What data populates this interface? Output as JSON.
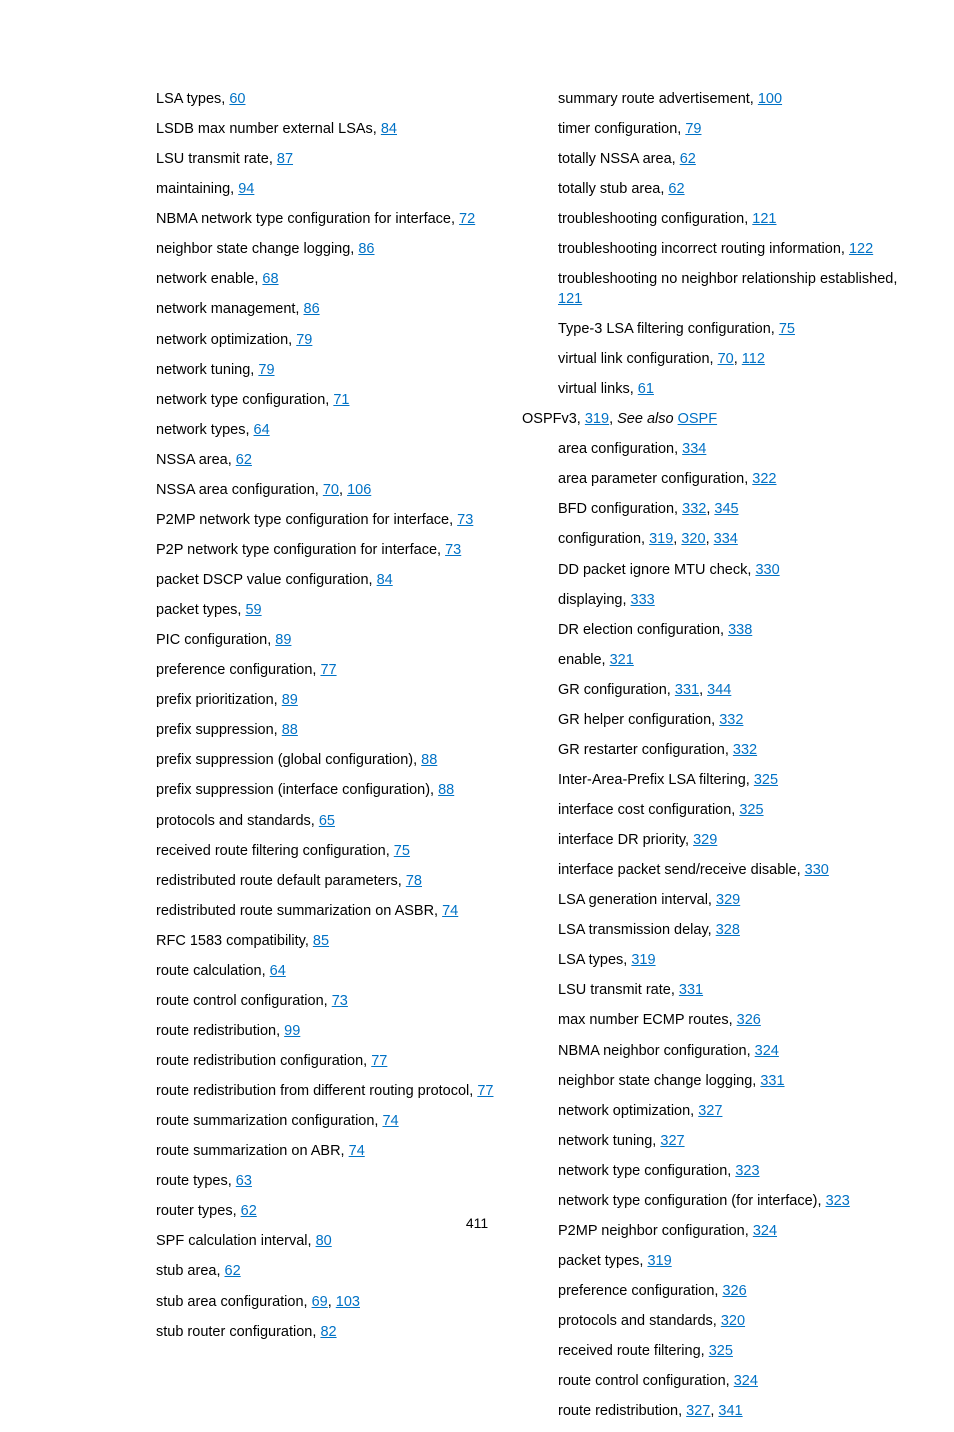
{
  "page_number": "411",
  "left": [
    {
      "text": "LSA types, ",
      "pages": [
        "60"
      ],
      "class": "indent1"
    },
    {
      "text": "LSDB max number external LSAs, ",
      "pages": [
        "84"
      ],
      "class": "indent1"
    },
    {
      "text": "LSU transmit rate, ",
      "pages": [
        "87"
      ],
      "class": "indent1"
    },
    {
      "text": "maintaining, ",
      "pages": [
        "94"
      ],
      "class": "indent1"
    },
    {
      "text": "NBMA network type configuration for interface, ",
      "pages": [
        "72"
      ],
      "class": "indent1"
    },
    {
      "text": "neighbor state change logging, ",
      "pages": [
        "86"
      ],
      "class": "indent1"
    },
    {
      "text": "network enable, ",
      "pages": [
        "68"
      ],
      "class": "indent1"
    },
    {
      "text": "network management, ",
      "pages": [
        "86"
      ],
      "class": "indent1"
    },
    {
      "text": "network optimization, ",
      "pages": [
        "79"
      ],
      "class": "indent1"
    },
    {
      "text": "network tuning, ",
      "pages": [
        "79"
      ],
      "class": "indent1"
    },
    {
      "text": "network type configuration, ",
      "pages": [
        "71"
      ],
      "class": "indent1"
    },
    {
      "text": "network types, ",
      "pages": [
        "64"
      ],
      "class": "indent1"
    },
    {
      "text": "NSSA area, ",
      "pages": [
        "62"
      ],
      "class": "indent1"
    },
    {
      "text": "NSSA area configuration, ",
      "pages": [
        "70",
        "106"
      ],
      "class": "indent1"
    },
    {
      "text": "P2MP network type configuration for interface, ",
      "pages": [
        "73"
      ],
      "class": "indent1"
    },
    {
      "text": "P2P network type configuration for interface, ",
      "pages": [
        "73"
      ],
      "class": "indent1"
    },
    {
      "text": "packet DSCP value configuration, ",
      "pages": [
        "84"
      ],
      "class": "indent1"
    },
    {
      "text": "packet types, ",
      "pages": [
        "59"
      ],
      "class": "indent1"
    },
    {
      "text": "PIC configuration, ",
      "pages": [
        "89"
      ],
      "class": "indent1"
    },
    {
      "text": "preference configuration, ",
      "pages": [
        "77"
      ],
      "class": "indent1"
    },
    {
      "text": "prefix prioritization, ",
      "pages": [
        "89"
      ],
      "class": "indent1"
    },
    {
      "text": "prefix suppression, ",
      "pages": [
        "88"
      ],
      "class": "indent1"
    },
    {
      "text": "prefix suppression (global configuration), ",
      "pages": [
        "88"
      ],
      "class": "indent1"
    },
    {
      "text": "prefix suppression (interface configuration), ",
      "pages": [
        "88"
      ],
      "class": "indent1"
    },
    {
      "text": "protocols and standards, ",
      "pages": [
        "65"
      ],
      "class": "indent1"
    },
    {
      "text": "received route filtering configuration, ",
      "pages": [
        "75"
      ],
      "class": "indent1"
    },
    {
      "text": "redistributed route default parameters, ",
      "pages": [
        "78"
      ],
      "class": "indent1"
    },
    {
      "text": "redistributed route summarization on ASBR, ",
      "pages": [
        "74"
      ],
      "class": "indent1"
    },
    {
      "text": "RFC 1583 compatibility, ",
      "pages": [
        "85"
      ],
      "class": "indent1"
    },
    {
      "text": "route calculation, ",
      "pages": [
        "64"
      ],
      "class": "indent1"
    },
    {
      "text": "route control configuration, ",
      "pages": [
        "73"
      ],
      "class": "indent1"
    },
    {
      "text": "route redistribution, ",
      "pages": [
        "99"
      ],
      "class": "indent1"
    },
    {
      "text": "route redistribution configuration, ",
      "pages": [
        "77"
      ],
      "class": "indent1"
    },
    {
      "text": "route redistribution from different routing protocol, ",
      "pages": [
        "77"
      ],
      "class": "indent1"
    },
    {
      "text": "route summarization configuration, ",
      "pages": [
        "74"
      ],
      "class": "indent1"
    },
    {
      "text": "route summarization on ABR, ",
      "pages": [
        "74"
      ],
      "class": "indent1"
    },
    {
      "text": "route types, ",
      "pages": [
        "63"
      ],
      "class": "indent1"
    },
    {
      "text": "router types, ",
      "pages": [
        "62"
      ],
      "class": "indent1"
    },
    {
      "text": "SPF calculation interval, ",
      "pages": [
        "80"
      ],
      "class": "indent1"
    },
    {
      "text": "stub area, ",
      "pages": [
        "62"
      ],
      "class": "indent1"
    },
    {
      "text": "stub area configuration, ",
      "pages": [
        "69",
        "103"
      ],
      "class": "indent1"
    },
    {
      "text": "stub router configuration, ",
      "pages": [
        "82"
      ],
      "class": "indent1"
    }
  ],
  "right": [
    {
      "text": "summary route advertisement, ",
      "pages": [
        "100"
      ],
      "class": "indent1"
    },
    {
      "text": "timer configuration, ",
      "pages": [
        "79"
      ],
      "class": "indent1"
    },
    {
      "text": "totally NSSA area, ",
      "pages": [
        "62"
      ],
      "class": "indent1"
    },
    {
      "text": "totally stub area, ",
      "pages": [
        "62"
      ],
      "class": "indent1"
    },
    {
      "text": "troubleshooting configuration, ",
      "pages": [
        "121"
      ],
      "class": "indent1"
    },
    {
      "text": "troubleshooting incorrect routing information, ",
      "pages": [
        "122"
      ],
      "class": "indent1"
    },
    {
      "text": "troubleshooting no neighbor relationship established, ",
      "pages": [
        "121"
      ],
      "class": "indent1"
    },
    {
      "text": "Type-3 LSA filtering configuration, ",
      "pages": [
        "75"
      ],
      "class": "indent1"
    },
    {
      "text": "virtual link configuration, ",
      "pages": [
        "70",
        "112"
      ],
      "class": "indent1"
    },
    {
      "text": "virtual links, ",
      "pages": [
        "61"
      ],
      "class": "indent1"
    },
    {
      "kind": "ospfv3",
      "class": "topic"
    },
    {
      "text": "area configuration, ",
      "pages": [
        "334"
      ],
      "class": "indent1"
    },
    {
      "text": "area parameter configuration, ",
      "pages": [
        "322"
      ],
      "class": "indent1"
    },
    {
      "text": "BFD configuration, ",
      "pages": [
        "332",
        "345"
      ],
      "class": "indent1"
    },
    {
      "text": "configuration, ",
      "pages": [
        "319",
        "320",
        "334"
      ],
      "class": "indent1"
    },
    {
      "text": "DD packet ignore MTU check, ",
      "pages": [
        "330"
      ],
      "class": "indent1"
    },
    {
      "text": "displaying, ",
      "pages": [
        "333"
      ],
      "class": "indent1"
    },
    {
      "text": "DR election configuration, ",
      "pages": [
        "338"
      ],
      "class": "indent1"
    },
    {
      "text": "enable, ",
      "pages": [
        "321"
      ],
      "class": "indent1"
    },
    {
      "text": "GR configuration, ",
      "pages": [
        "331",
        "344"
      ],
      "class": "indent1"
    },
    {
      "text": "GR helper configuration, ",
      "pages": [
        "332"
      ],
      "class": "indent1"
    },
    {
      "text": "GR restarter configuration, ",
      "pages": [
        "332"
      ],
      "class": "indent1"
    },
    {
      "text": "Inter-Area-Prefix LSA filtering, ",
      "pages": [
        "325"
      ],
      "class": "indent1"
    },
    {
      "text": "interface cost configuration, ",
      "pages": [
        "325"
      ],
      "class": "indent1"
    },
    {
      "text": "interface DR priority, ",
      "pages": [
        "329"
      ],
      "class": "indent1"
    },
    {
      "text": "interface packet send/receive disable, ",
      "pages": [
        "330"
      ],
      "class": "indent1"
    },
    {
      "text": "LSA generation interval, ",
      "pages": [
        "329"
      ],
      "class": "indent1"
    },
    {
      "text": "LSA transmission delay, ",
      "pages": [
        "328"
      ],
      "class": "indent1"
    },
    {
      "text": "LSA types, ",
      "pages": [
        "319"
      ],
      "class": "indent1"
    },
    {
      "text": "LSU transmit rate, ",
      "pages": [
        "331"
      ],
      "class": "indent1"
    },
    {
      "text": "max number ECMP routes, ",
      "pages": [
        "326"
      ],
      "class": "indent1"
    },
    {
      "text": "NBMA neighbor configuration, ",
      "pages": [
        "324"
      ],
      "class": "indent1"
    },
    {
      "text": "neighbor state change logging, ",
      "pages": [
        "331"
      ],
      "class": "indent1"
    },
    {
      "text": "network optimization, ",
      "pages": [
        "327"
      ],
      "class": "indent1"
    },
    {
      "text": "network tuning, ",
      "pages": [
        "327"
      ],
      "class": "indent1"
    },
    {
      "text": "network type configuration, ",
      "pages": [
        "323"
      ],
      "class": "indent1"
    },
    {
      "text": "network type configuration (for interface), ",
      "pages": [
        "323"
      ],
      "class": "indent1"
    },
    {
      "text": "P2MP neighbor configuration, ",
      "pages": [
        "324"
      ],
      "class": "indent1"
    },
    {
      "text": "packet types, ",
      "pages": [
        "319"
      ],
      "class": "indent1"
    },
    {
      "text": "preference configuration, ",
      "pages": [
        "326"
      ],
      "class": "indent1"
    },
    {
      "text": "protocols and standards, ",
      "pages": [
        "320"
      ],
      "class": "indent1"
    },
    {
      "text": "received route filtering, ",
      "pages": [
        "325"
      ],
      "class": "indent1"
    },
    {
      "text": "route control configuration, ",
      "pages": [
        "324"
      ],
      "class": "indent1"
    },
    {
      "text": "route redistribution, ",
      "pages": [
        "327",
        "341"
      ],
      "class": "indent1"
    }
  ],
  "ospfv3": {
    "label": "OSPFv3, ",
    "page": "319",
    "see_also_prefix": ", ",
    "see_also_italic": "See also",
    "see_also_space": " ",
    "see_also_link": "OSPF"
  }
}
